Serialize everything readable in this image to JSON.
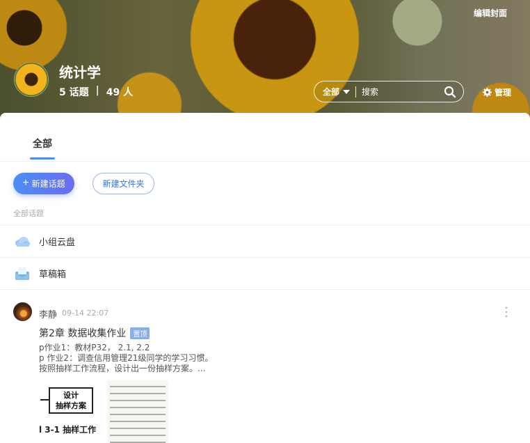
{
  "banner": {
    "edit_cover": "编辑封面",
    "group_title": "统计学",
    "topics_count": "5 话题",
    "separator": "|",
    "members_count": "49 人",
    "search": {
      "scope": "全部",
      "placeholder": "搜索"
    },
    "manage": "管理"
  },
  "tabs": [
    {
      "label": "全部",
      "active": true
    }
  ],
  "actions": {
    "new_topic": "新建话题",
    "new_folder": "新建文件夹"
  },
  "section_label": "全部话题",
  "rows": [
    {
      "label": "小组云盘",
      "icon": "cloud-icon"
    },
    {
      "label": "草稿箱",
      "icon": "drafts-icon"
    }
  ],
  "post": {
    "author": "李静",
    "time": "09-14 22:07",
    "title": "第2章 数据收集作业",
    "badge": "置顶",
    "lines": [
      "p作业1：教材P32， 2.1, 2.2",
      "p 作业2：调查信用管理21级同学的学习习惯。",
      "按照抽样工作流程，设计出一份抽样方案。..."
    ],
    "thumb1": {
      "box_text": "设计\n抽样方案",
      "caption": "l 3-1  抽样工作"
    }
  },
  "colors": {
    "accent": "#4d8ef2",
    "badge": "#8aaee8",
    "folder_border": "#9ab8e8"
  }
}
